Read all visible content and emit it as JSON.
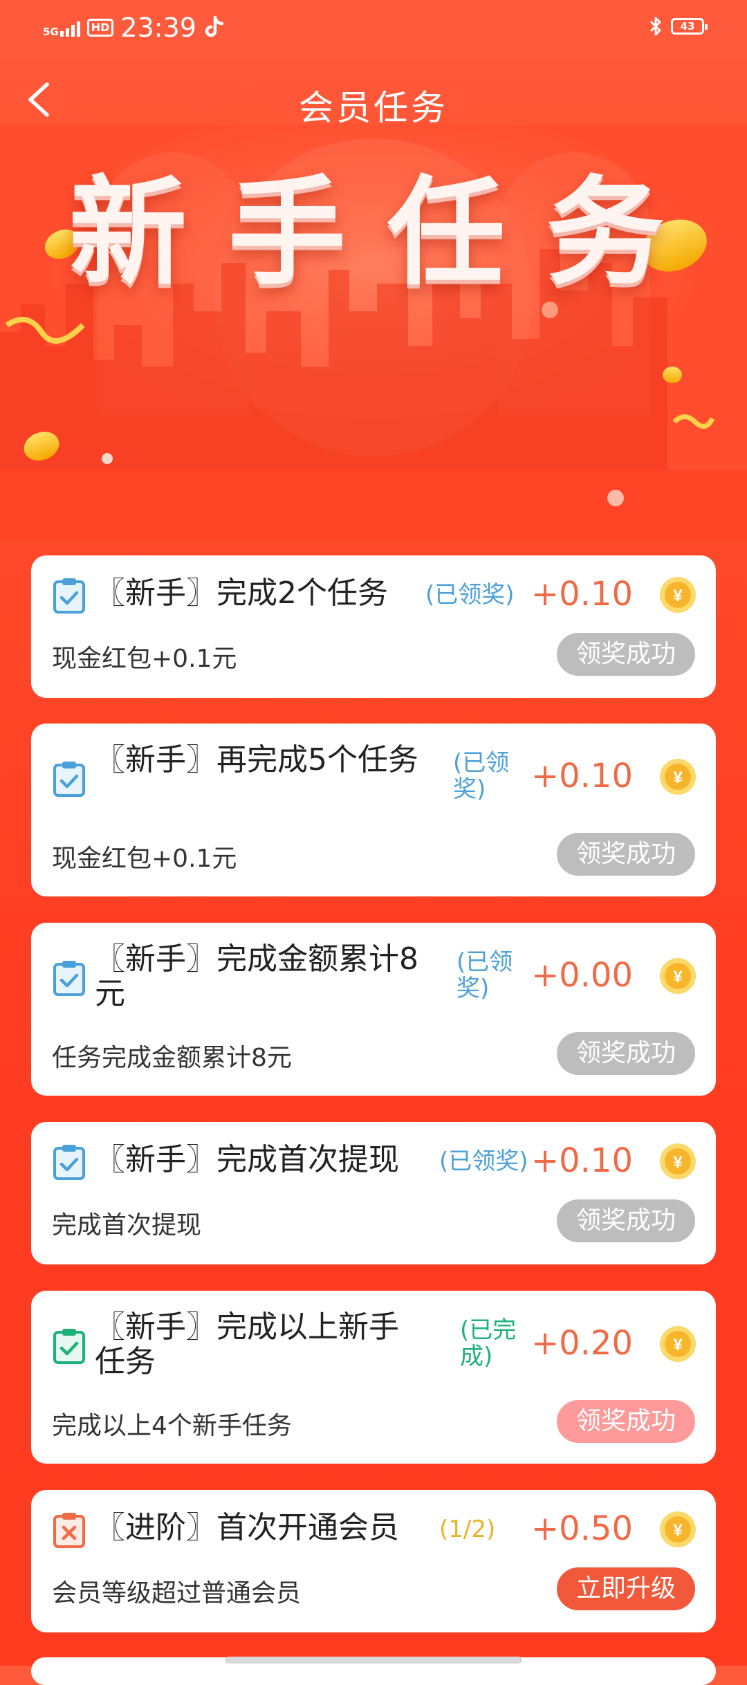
{
  "status_bar": {
    "network": "5G",
    "hd": "HD",
    "time": "23:39",
    "battery": "43"
  },
  "header": {
    "title": "会员任务"
  },
  "banner": {
    "title": "新手任务"
  },
  "colors": {
    "primary": "#ff4a2a",
    "reward": "#f06a46",
    "claimed_status": "#4aa0d8",
    "completed_status": "#1db07a",
    "progress_status": "#e7b327",
    "button_gray": "#bdbdbd",
    "button_pink": "#ff9a9a",
    "button_red": "#f2583a"
  },
  "tasks": [
    {
      "title": "〖新手〗完成2个任务",
      "status": "(已领奖)",
      "reward": "+0.10",
      "desc": "现金红包+0.1元",
      "button": "领奖成功",
      "icon": "clipboard-check-icon"
    },
    {
      "title": "〖新手〗再完成5个任务",
      "status": "(已领奖)",
      "reward": "+0.10",
      "desc": "现金红包+0.1元",
      "button": "领奖成功",
      "icon": "clipboard-check-icon"
    },
    {
      "title": "〖新手〗完成金额累计8元",
      "status": "(已领奖)",
      "reward": "+0.00",
      "desc": "任务完成金额累计8元",
      "button": "领奖成功",
      "icon": "clipboard-check-icon"
    },
    {
      "title": "〖新手〗完成首次提现",
      "status": "(已领奖)",
      "reward": "+0.10",
      "desc": "完成首次提现",
      "button": "领奖成功",
      "icon": "clipboard-check-icon"
    },
    {
      "title": "〖新手〗完成以上新手任务",
      "status": "(已完成)",
      "reward": "+0.20",
      "desc": "完成以上4个新手任务",
      "button": "领奖成功",
      "icon": "clipboard-check-icon"
    },
    {
      "title": "〖进阶〗首次开通会员",
      "status": "(1/2)",
      "reward": "+0.50",
      "desc": "会员等级超过普通会员",
      "button": "立即升级",
      "icon": "clipboard-x-icon"
    }
  ]
}
